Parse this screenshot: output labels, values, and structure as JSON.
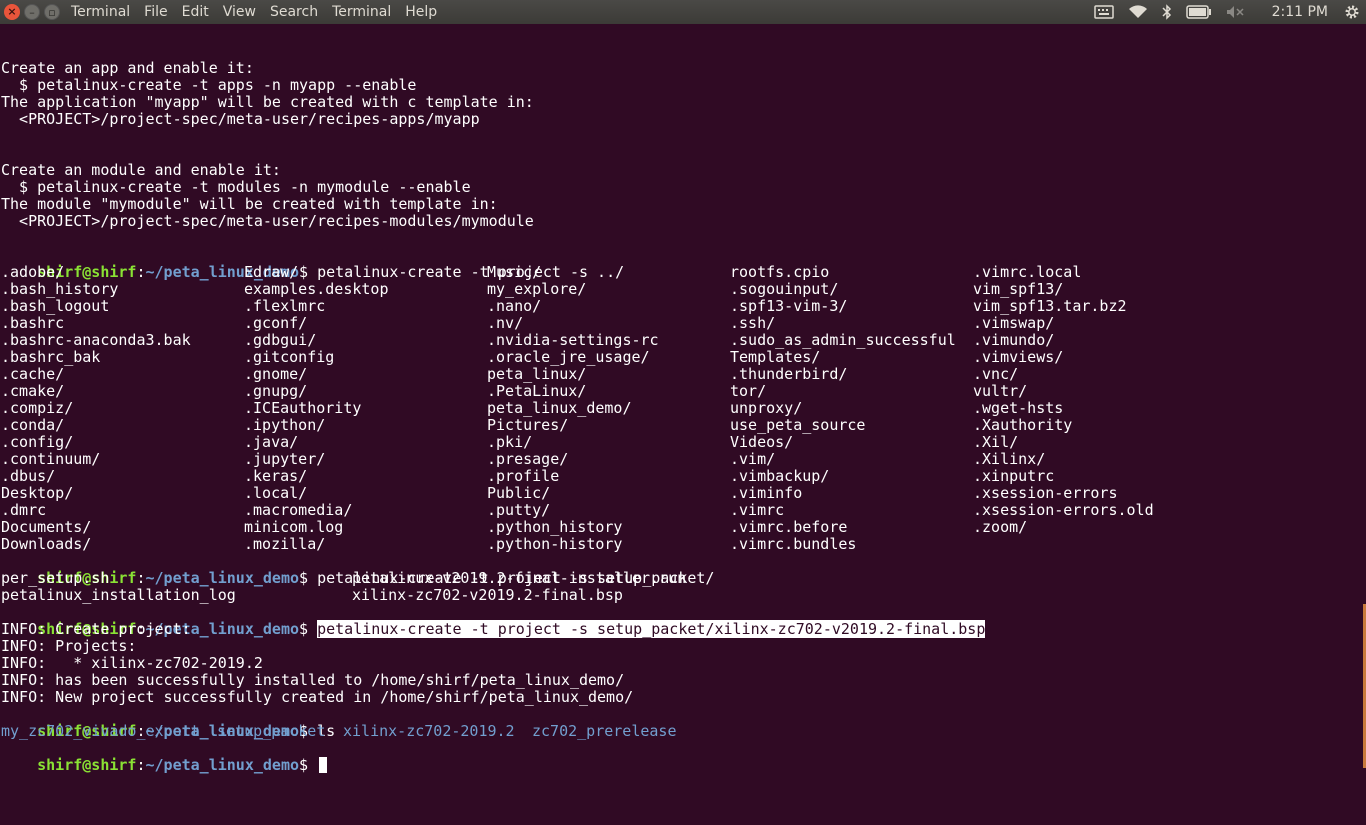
{
  "menubar": {
    "app": "Terminal",
    "items": [
      "File",
      "Edit",
      "View",
      "Search",
      "Terminal",
      "Help"
    ]
  },
  "tray": {
    "icons": [
      "keyboard-icon",
      "wifi-icon",
      "bluetooth-icon",
      "battery-icon",
      "volume-muted-icon",
      "settings-gear-icon"
    ],
    "clock": "2:11 PM"
  },
  "prompt": {
    "user": "shirf@shirf",
    "sep": ":",
    "path": "~/peta_linux_demo",
    "sym": "$ "
  },
  "help_text": [
    "Create an app and enable it:",
    "  $ petalinux-create -t apps -n myapp --enable",
    "The application \"myapp\" will be created with c template in:",
    "  <PROJECT>/project-spec/meta-user/recipes-apps/myapp",
    "Create an module and enable it:",
    "  $ petalinux-create -t modules -n mymodule --enable",
    "The module \"mymodule\" will be created with template in:",
    "  <PROJECT>/project-spec/meta-user/recipes-modules/mymodule"
  ],
  "commands": [
    "petalinux-create -t project -s ../",
    "petalinux-create -t project -s setup_packet/",
    "petalinux-create -t project -s setup_packet/xilinx-zc702-v2019.2-final.bsp",
    "ls"
  ],
  "completion_home": [
    [
      ".adobe/",
      "Edraw/",
      "Music/",
      "rootfs.cpio",
      ".vimrc.local"
    ],
    [
      ".bash_history",
      "examples.desktop",
      "my_explore/",
      ".sogouinput/",
      "vim_spf13/"
    ],
    [
      ".bash_logout",
      ".flexlmrc",
      ".nano/",
      ".spf13-vim-3/",
      "vim_spf13.tar.bz2"
    ],
    [
      ".bashrc",
      ".gconf/",
      ".nv/",
      ".ssh/",
      ".vimswap/"
    ],
    [
      ".bashrc-anaconda3.bak",
      ".gdbgui/",
      ".nvidia-settings-rc",
      ".sudo_as_admin_successful",
      ".vimundo/"
    ],
    [
      ".bashrc_bak",
      ".gitconfig",
      ".oracle_jre_usage/",
      "Templates/",
      ".vimviews/"
    ],
    [
      ".cache/",
      ".gnome/",
      "peta_linux/",
      ".thunderbird/",
      ".vnc/"
    ],
    [
      ".cmake/",
      ".gnupg/",
      ".PetaLinux/",
      "tor/",
      "vultr/"
    ],
    [
      ".compiz/",
      ".ICEauthority",
      "peta_linux_demo/",
      "unproxy/",
      ".wget-hsts"
    ],
    [
      ".conda/",
      ".ipython/",
      "Pictures/",
      "use_peta_source",
      ".Xauthority"
    ],
    [
      ".config/",
      ".java/",
      ".pki/",
      "Videos/",
      ".Xil/"
    ],
    [
      ".continuum/",
      ".jupyter/",
      ".presage/",
      ".vim/",
      ".Xilinx/"
    ],
    [
      ".dbus/",
      ".keras/",
      ".profile",
      ".vimbackup/",
      ".xinputrc"
    ],
    [
      "Desktop/",
      ".local/",
      "Public/",
      ".viminfo",
      ".xsession-errors"
    ],
    [
      ".dmrc",
      ".macromedia/",
      ".putty/",
      ".vimrc",
      ".xsession-errors.old"
    ],
    [
      "Documents/",
      "minicom.log",
      ".python_history",
      ".vimrc.before",
      ".zoom/"
    ],
    [
      "Downloads/",
      ".mozilla/",
      ".python-history",
      ".vimrc.bundles",
      ""
    ]
  ],
  "completion_packet": [
    [
      "per_setup.sh",
      "petalinux-v2019.2-final-installer.run"
    ],
    [
      "petalinux_installation_log",
      "xilinx-zc702-v2019.2-final.bsp"
    ]
  ],
  "info_lines": [
    "INFO: Create project:",
    "INFO: Projects:",
    "INFO:   * xilinx-zc702-2019.2",
    "INFO: has been successfully installed to /home/shirf/peta_linux_demo/",
    "INFO: New project successfully created in /home/shirf/peta_linux_demo/"
  ],
  "ls_output": [
    "my_zc702_vivado_export",
    "setup_packet",
    "xilinx-zc702-2019.2",
    "zc702_prerelease"
  ]
}
